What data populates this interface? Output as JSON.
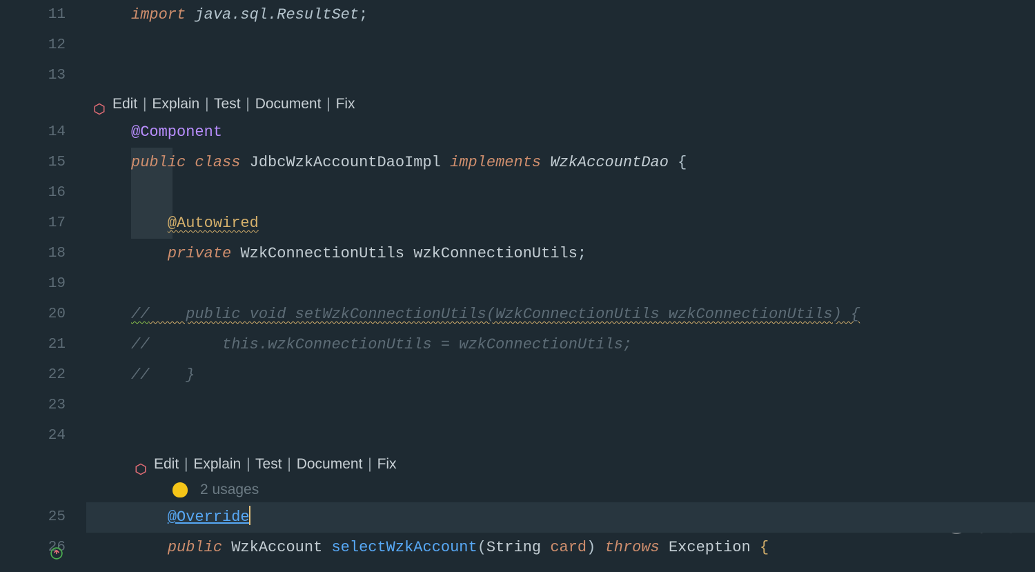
{
  "gutter": {
    "lines": [
      "11",
      "12",
      "13",
      "14",
      "15",
      "16",
      "17",
      "18",
      "19",
      "20",
      "21",
      "22",
      "23",
      "24",
      "25",
      "26"
    ]
  },
  "inlay1": {
    "edit": "Edit",
    "explain": "Explain",
    "test": "Test",
    "document": "Document",
    "fix": "Fix"
  },
  "inlay2": {
    "edit": "Edit",
    "explain": "Explain",
    "test": "Test",
    "document": "Document",
    "fix": "Fix",
    "usages": "2 usages"
  },
  "code": {
    "l11": {
      "import": "import",
      "pkg": "java.sql.ResultSet",
      "semi": ";"
    },
    "l14": {
      "ann": "@Component"
    },
    "l15": {
      "public": "public",
      "class": "class",
      "name": "JdbcWzkAccountDaoImpl",
      "implements": "implements",
      "iface": "WzkAccountDao",
      "brace": "{"
    },
    "l17": {
      "indent": "    ",
      "ann": "@Autowired"
    },
    "l18": {
      "indent": "    ",
      "private": "private",
      "type": "WzkConnectionUtils",
      "field": "wzkConnectionUtils",
      "semi": ";"
    },
    "l20": {
      "pre": "//",
      "rest": "    public void setWzkConnectionUtils(WzkConnectionUtils wzkConnectionUtils) {"
    },
    "l21": {
      "pre": "//",
      "rest": "        this.wzkConnectionUtils = wzkConnectionUtils;"
    },
    "l22": {
      "pre": "//",
      "rest": "    }"
    },
    "l25": {
      "indent": "    ",
      "ann": "@Override"
    },
    "l26": {
      "indent": "    ",
      "public": "public",
      "type": "WzkAccount",
      "method": "selectWzkAccount",
      "lp": "(",
      "ptype": "String",
      "pname": "card",
      "rp": ")",
      "throws": "throws",
      "exc": "Exception",
      "brace": "{"
    }
  },
  "watermark": "CSDN @武子康"
}
